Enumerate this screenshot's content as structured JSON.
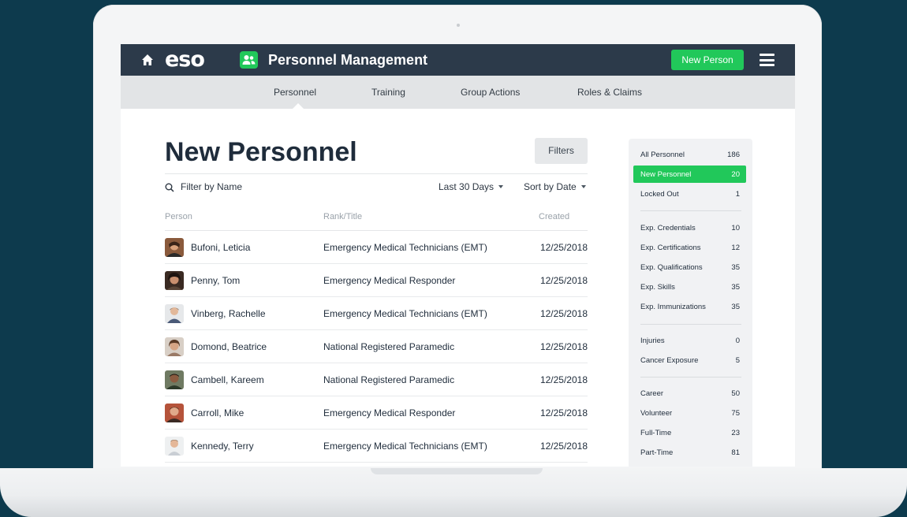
{
  "header": {
    "logo_text": "eso",
    "app_title": "Personnel Management",
    "new_person_label": "New Person"
  },
  "tabs": [
    "Personnel",
    "Training",
    "Group Actions",
    "Roles & Claims"
  ],
  "page": {
    "title": "New Personnel",
    "filters_label": "Filters",
    "search_placeholder": "Filter by Name",
    "range_label": "Last 30 Days",
    "sort_label": "Sort by Date"
  },
  "table": {
    "columns": [
      "Person",
      "Rank/Title",
      "Created"
    ],
    "rows": [
      {
        "name": "Bufoni, Leticia",
        "rank": "Emergency Medical Technicians (EMT)",
        "created": "12/25/2018"
      },
      {
        "name": "Penny, Tom",
        "rank": "Emergency Medical Responder",
        "created": "12/25/2018"
      },
      {
        "name": "Vinberg, Rachelle",
        "rank": "Emergency Medical Technicians (EMT)",
        "created": "12/25/2018"
      },
      {
        "name": "Domond, Beatrice",
        "rank": "National Registered Paramedic",
        "created": "12/25/2018"
      },
      {
        "name": "Cambell, Kareem",
        "rank": "National Registered Paramedic",
        "created": "12/25/2018"
      },
      {
        "name": "Carroll, Mike",
        "rank": "Emergency Medical Responder",
        "created": "12/25/2018"
      },
      {
        "name": "Kennedy, Terry",
        "rank": "Emergency Medical Technicians (EMT)",
        "created": "12/25/2018"
      }
    ]
  },
  "sidebar": {
    "groups": [
      [
        {
          "label": "All Personnel",
          "count": "186"
        },
        {
          "label": "New Personnel",
          "count": "20",
          "active": true
        },
        {
          "label": "Locked Out",
          "count": "1"
        }
      ],
      [
        {
          "label": "Exp. Credentials",
          "count": "10"
        },
        {
          "label": "Exp. Certifications",
          "count": "12"
        },
        {
          "label": "Exp. Qualifications",
          "count": "35"
        },
        {
          "label": "Exp. Skills",
          "count": "35"
        },
        {
          "label": "Exp. Immunizations",
          "count": "35"
        }
      ],
      [
        {
          "label": "Injuries",
          "count": "0"
        },
        {
          "label": "Cancer Exposure",
          "count": "5"
        }
      ],
      [
        {
          "label": "Career",
          "count": "50"
        },
        {
          "label": "Volunteer",
          "count": "75"
        },
        {
          "label": "Full-Time",
          "count": "23"
        },
        {
          "label": "Part-Time",
          "count": "81"
        }
      ]
    ]
  },
  "colors": {
    "accent": "#21c85a",
    "topbar": "#2c3a4a",
    "background": "#0d3a4d"
  },
  "icons": [
    "home-icon",
    "people-icon",
    "menu-icon",
    "search-icon",
    "chevron-down-icon",
    "avatar"
  ]
}
